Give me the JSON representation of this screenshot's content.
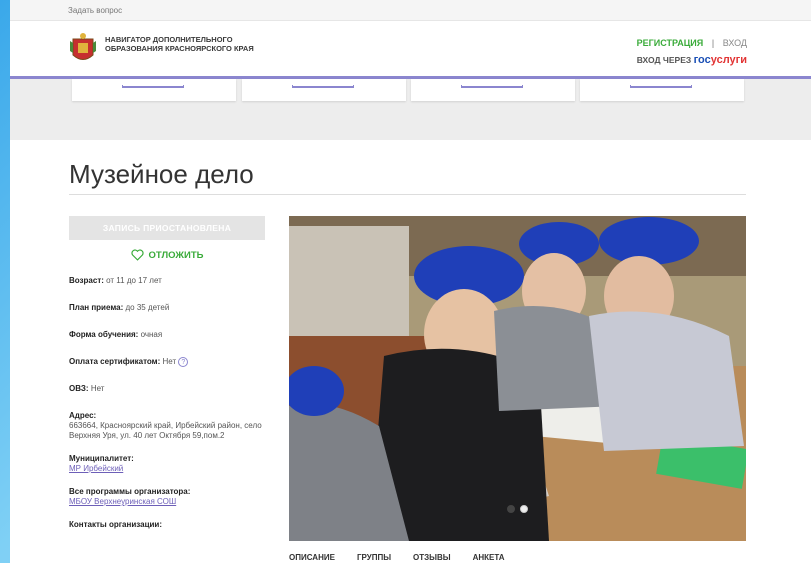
{
  "topbar": {
    "ask": "Задать вопрос"
  },
  "header": {
    "logo_text": "НАВИГАТОР ДОПОЛНИТЕЛЬНОГО ОБРАЗОВАНИЯ КРАСНОЯРСКОГО КРАЯ",
    "register": "РЕГИСТРАЦИЯ",
    "separator": "|",
    "login": "ВХОД",
    "login_via": "ВХОД ЧЕРЕЗ",
    "gos_part1": "гос",
    "gos_part2": "услуги"
  },
  "page_title": "Музейное дело",
  "sidebar": {
    "status_button": "ЗАПИСЬ ПРИОСТАНОВЛЕНА",
    "postpone": "ОТЛОЖИТЬ",
    "age_label": "Возраст:",
    "age_value": "от 11 до 17 лет",
    "plan_label": "План приема:",
    "plan_value": "до 35 детей",
    "form_label": "Форма обучения:",
    "form_value": "очная",
    "pay_label": "Оплата сертификатом:",
    "pay_value": "Нет",
    "help_glyph": "?",
    "ovz_label": "ОВЗ:",
    "ovz_value": "Нет",
    "address_label": "Адрес:",
    "address_value": "663664, Красноярский край, Ирбейский район, село Верхняя Уря, ул. 40 лет Октября 59,пом.2",
    "municipality_label": "Муниципалитет:",
    "municipality_value": "МР Ирбейский",
    "programs_label": "Все программы организатора:",
    "programs_value": "МБОУ Верхнеуринская СОШ",
    "contacts_label": "Контакты организации:"
  },
  "tabs": [
    "ОПИСАНИЕ",
    "ГРУППЫ",
    "ОТЗЫВЫ",
    "АНКЕТА"
  ],
  "colors": {
    "accent": "#8b86cf",
    "green": "#3aab3a",
    "link": "#6d5fb8"
  }
}
